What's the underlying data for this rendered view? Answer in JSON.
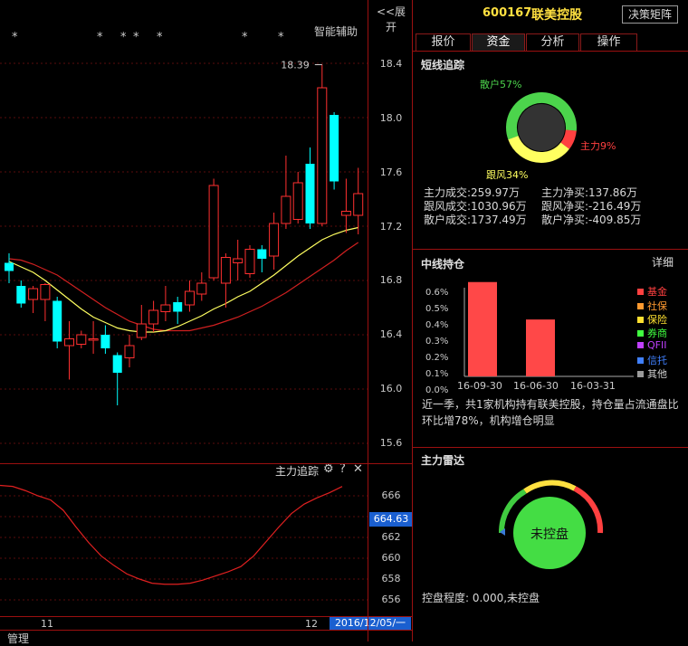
{
  "top": {
    "expand_label": "<<展开",
    "stock_code": "600167",
    "stock_name": "联美控股",
    "decision_btn": "决策矩阵"
  },
  "tabs": [
    "报价",
    "资金",
    "分析",
    "操作"
  ],
  "main_chart": {
    "assist_label": "智能辅助",
    "peak_label": "18.39",
    "y_ticks": [
      "18.4",
      "18.0",
      "17.6",
      "17.2",
      "16.8",
      "16.4",
      "16.0",
      "15.6"
    ],
    "x_labels": [
      "11",
      "12"
    ],
    "date_label": "2016/12/05/一",
    "footer_label": "管理"
  },
  "chart_data": {
    "type": "candlestick",
    "ylim": [
      15.5,
      18.5
    ],
    "candles": [
      {
        "o": 16.93,
        "c": 16.87,
        "h": 17.0,
        "l": 16.78
      },
      {
        "o": 16.76,
        "c": 16.63,
        "h": 16.8,
        "l": 16.6
      },
      {
        "o": 16.66,
        "c": 16.74,
        "h": 16.76,
        "l": 16.56
      },
      {
        "o": 16.66,
        "c": 16.77,
        "h": 16.78,
        "l": 16.5
      },
      {
        "o": 16.65,
        "c": 16.35,
        "h": 16.68,
        "l": 16.3
      },
      {
        "o": 16.32,
        "c": 16.37,
        "h": 16.5,
        "l": 16.07
      },
      {
        "o": 16.33,
        "c": 16.4,
        "h": 16.43,
        "l": 16.3
      },
      {
        "o": 16.37,
        "c": 16.37,
        "h": 16.5,
        "l": 16.26
      },
      {
        "o": 16.4,
        "c": 16.3,
        "h": 16.47,
        "l": 16.26
      },
      {
        "o": 16.25,
        "c": 16.12,
        "h": 16.27,
        "l": 15.88
      },
      {
        "o": 16.23,
        "c": 16.32,
        "h": 16.4,
        "l": 16.16
      },
      {
        "o": 16.38,
        "c": 16.48,
        "h": 16.62,
        "l": 16.36
      },
      {
        "o": 16.48,
        "c": 16.58,
        "h": 16.65,
        "l": 16.42
      },
      {
        "o": 16.57,
        "c": 16.62,
        "h": 16.76,
        "l": 16.5
      },
      {
        "o": 16.64,
        "c": 16.57,
        "h": 16.68,
        "l": 16.48
      },
      {
        "o": 16.62,
        "c": 16.72,
        "h": 16.8,
        "l": 16.57
      },
      {
        "o": 16.7,
        "c": 16.78,
        "h": 16.86,
        "l": 16.65
      },
      {
        "o": 16.82,
        "c": 17.5,
        "h": 17.55,
        "l": 16.8
      },
      {
        "o": 16.78,
        "c": 16.97,
        "h": 17.0,
        "l": 16.6
      },
      {
        "o": 16.93,
        "c": 16.96,
        "h": 17.1,
        "l": 16.8
      },
      {
        "o": 16.85,
        "c": 17.03,
        "h": 17.06,
        "l": 16.82
      },
      {
        "o": 17.03,
        "c": 16.96,
        "h": 17.06,
        "l": 16.86
      },
      {
        "o": 16.98,
        "c": 17.22,
        "h": 17.3,
        "l": 16.88
      },
      {
        "o": 17.22,
        "c": 17.42,
        "h": 17.72,
        "l": 17.18
      },
      {
        "o": 17.25,
        "c": 17.52,
        "h": 17.6,
        "l": 17.22
      },
      {
        "o": 17.66,
        "c": 17.22,
        "h": 17.78,
        "l": 17.18
      },
      {
        "o": 17.22,
        "c": 18.22,
        "h": 18.39,
        "l": 17.2
      },
      {
        "o": 18.02,
        "c": 17.53,
        "h": 18.04,
        "l": 17.47
      },
      {
        "o": 17.28,
        "c": 17.31,
        "h": 17.55,
        "l": 17.15
      },
      {
        "o": 17.28,
        "c": 17.44,
        "h": 17.63,
        "l": 17.14
      }
    ],
    "ma_yellow": [
      16.94,
      16.9,
      16.86,
      16.8,
      16.73,
      16.66,
      16.59,
      16.53,
      16.49,
      16.45,
      16.43,
      16.42,
      16.42,
      16.43,
      16.46,
      16.5,
      16.54,
      16.59,
      16.63,
      16.68,
      16.72,
      16.78,
      16.84,
      16.91,
      16.98,
      17.04,
      17.1,
      17.14,
      17.17,
      17.19
    ],
    "ma_red": [
      16.96,
      16.95,
      16.92,
      16.88,
      16.84,
      16.78,
      16.72,
      16.66,
      16.6,
      16.55,
      16.5,
      16.47,
      16.44,
      16.43,
      16.43,
      16.43,
      16.45,
      16.47,
      16.5,
      16.53,
      16.57,
      16.61,
      16.66,
      16.71,
      16.77,
      16.83,
      16.89,
      16.95,
      17.02,
      17.08
    ]
  },
  "sub_chart": {
    "title": "主力追踪",
    "y_ticks": [
      "666",
      "664",
      "662",
      "660",
      "658",
      "656"
    ],
    "current": "664.63",
    "ylim": [
      655,
      667.5
    ],
    "values": [
      667.0,
      666.9,
      666.5,
      666.0,
      665.6,
      664.6,
      663.0,
      661.5,
      660.2,
      659.3,
      658.5,
      658.0,
      657.6,
      657.5,
      657.5,
      657.6,
      657.9,
      658.3,
      658.7,
      659.2,
      660.2,
      661.6,
      663.0,
      664.3,
      665.2,
      665.8,
      666.3,
      666.9
    ]
  },
  "short_term": {
    "title": "短线追踪",
    "donut": [
      {
        "name": "散户57%",
        "value": 57,
        "color": "#4cd44c"
      },
      {
        "name": "主力9%",
        "value": 9,
        "color": "#ff4040"
      },
      {
        "name": "跟风34%",
        "value": 34,
        "color": "#ffff60"
      }
    ],
    "stats": [
      [
        "主力成交:259.97万",
        "主力净买:137.86万"
      ],
      [
        "跟风成交:1030.96万",
        "跟风净买:-216.49万"
      ],
      [
        "散户成交:1737.49万",
        "散户净买:-409.85万"
      ]
    ]
  },
  "mid_term": {
    "title": "中线持仓",
    "detail": "详细",
    "y_ticks": [
      "0.6%",
      "0.5%",
      "0.4%",
      "0.3%",
      "0.2%",
      "0.1%",
      "0.0%"
    ],
    "x_labels": [
      "16-09-30",
      "16-06-30",
      "16-03-31"
    ],
    "bars": [
      0.68,
      0.41,
      0.0
    ],
    "legend": [
      {
        "label": "基金",
        "color": "#ff4040"
      },
      {
        "label": "社保",
        "color": "#ff9a30"
      },
      {
        "label": "保险",
        "color": "#ffe030"
      },
      {
        "label": "券商",
        "color": "#40ff40"
      },
      {
        "label": "QFII",
        "color": "#c040ff"
      },
      {
        "label": "信托",
        "color": "#4080ff"
      },
      {
        "label": "其他",
        "color": "#9a9a9a"
      }
    ],
    "note": "近一季，共1家机构持有联美控股，持仓量占流通盘比环比增78%，机构增仓明显"
  },
  "radar": {
    "title": "主力雷达",
    "center_label": "未控盘",
    "control_text": "控盘程度: 0.000,未控盘"
  }
}
